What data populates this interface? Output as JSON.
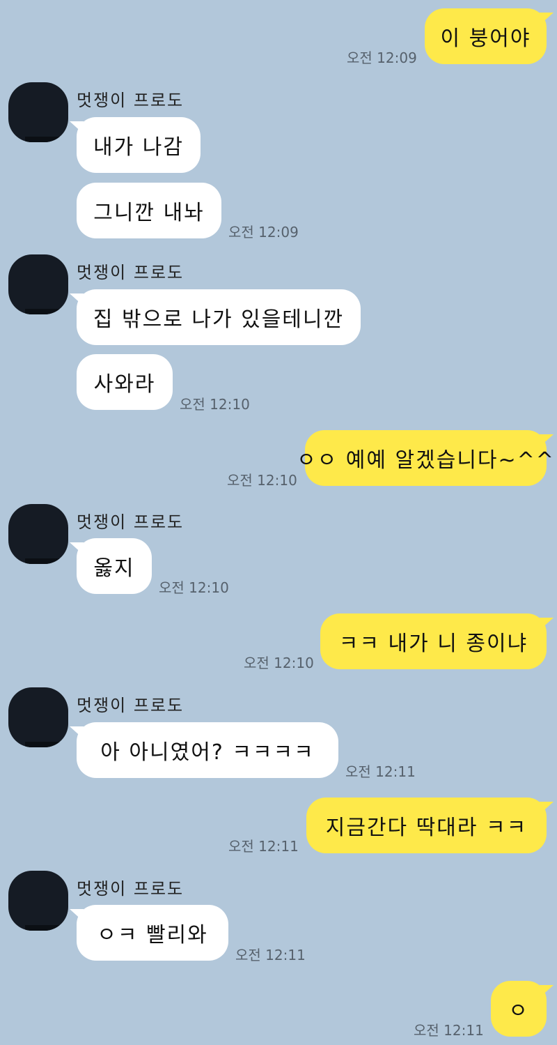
{
  "sender_name": "멋쟁이 프로도",
  "colors": {
    "background": "#b2c7da",
    "outgoing_bubble": "#fee94a",
    "incoming_bubble": "#ffffff"
  },
  "messages": [
    {
      "from": "me",
      "text": "이 붕어야",
      "time": "오전 12:09"
    },
    {
      "from": "frodo",
      "text": "내가 나감"
    },
    {
      "from": "frodo",
      "text": "그니깐 내놔",
      "time": "오전 12:09"
    },
    {
      "from": "frodo",
      "text": "집 밖으로 나가 있을테니깐"
    },
    {
      "from": "frodo",
      "text": "사와라",
      "time": "오전 12:10"
    },
    {
      "from": "me",
      "text": "ㅇㅇ 예예 알겠습니다~^^",
      "time": "오전 12:10"
    },
    {
      "from": "frodo",
      "text": "옳지",
      "time": "오전 12:10"
    },
    {
      "from": "me",
      "text": "ㅋㅋ 내가 니 종이냐",
      "time": "오전 12:10"
    },
    {
      "from": "frodo",
      "text": "아 아니였어? ㅋㅋㅋㅋ",
      "time": "오전 12:11"
    },
    {
      "from": "me",
      "text": "지금간다 딱대라 ㅋㅋ",
      "time": "오전 12:11"
    },
    {
      "from": "frodo",
      "text": "ㅇㅋ 빨리와",
      "time": "오전 12:11"
    },
    {
      "from": "me",
      "text": "ㅇ",
      "time": "오전 12:11"
    }
  ]
}
